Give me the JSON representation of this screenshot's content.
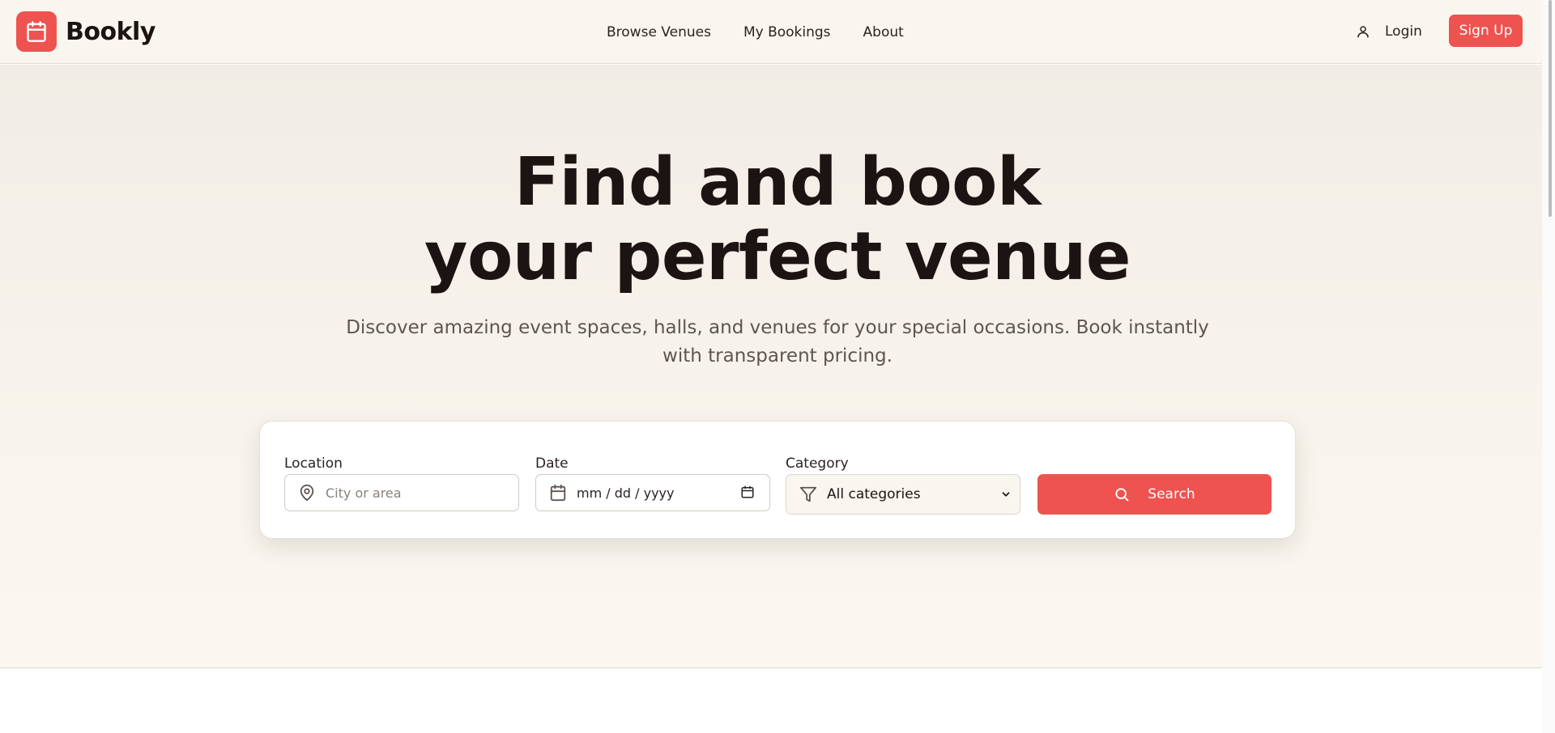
{
  "header": {
    "brand": "Bookly",
    "nav": [
      "Browse Venues",
      "My Bookings",
      "About"
    ],
    "login_label": "Login",
    "signup_label": "Sign Up"
  },
  "hero": {
    "title_line1": "Find and book",
    "title_line2": "your perfect venue",
    "subtitle": "Discover amazing event spaces, halls, and venues for your special occasions. Book instantly with transparent pricing."
  },
  "search": {
    "location_label": "Location",
    "location_placeholder": "City or area",
    "date_label": "Date",
    "date_placeholder": "mm / dd / yyyy",
    "category_label": "Category",
    "category_value": "All categories",
    "button_label": "Search"
  },
  "colors": {
    "accent": "#ee5350",
    "background": "#f9f6f0",
    "text": "#1c1412"
  },
  "icons": {
    "logo": "calendar-icon",
    "login": "user-icon",
    "location": "map-pin-icon",
    "date": "calendar-icon",
    "category": "filter-icon",
    "search": "search-icon"
  }
}
